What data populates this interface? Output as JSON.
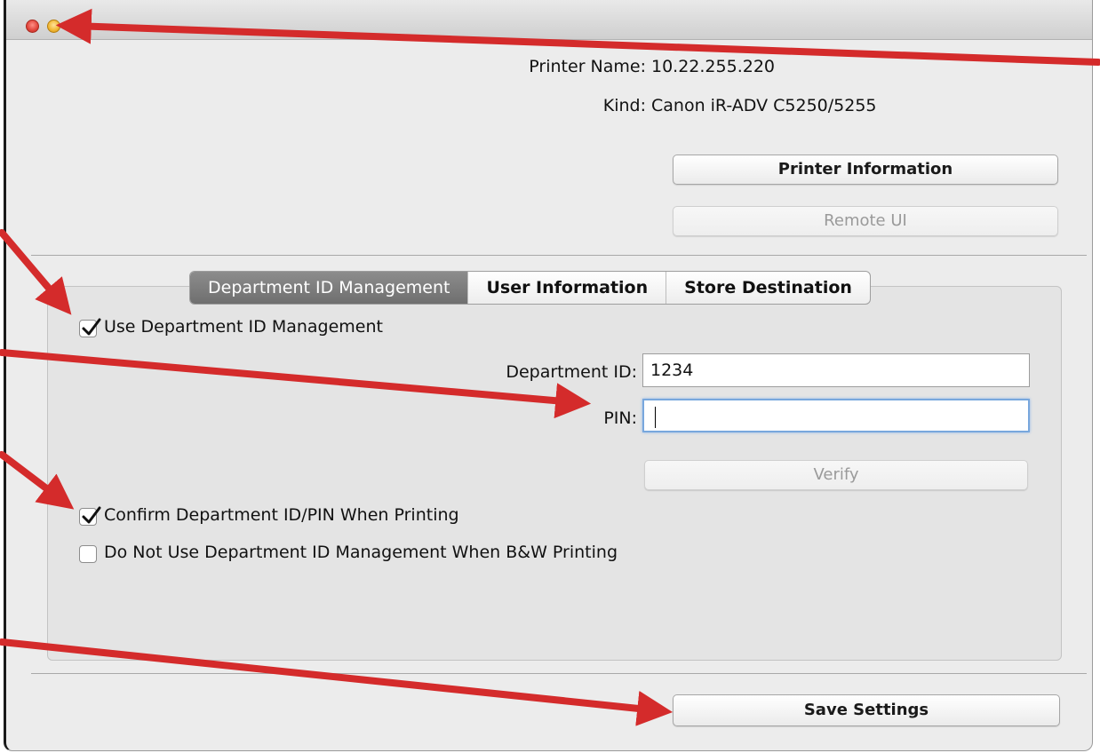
{
  "printer": {
    "name_label": "Printer Name:",
    "name_value": "10.22.255.220",
    "kind_label": "Kind:",
    "kind_value": "Canon iR-ADV C5250/5255",
    "info_button": "Printer Information",
    "remote_button": "Remote UI"
  },
  "tabs": [
    {
      "label": "Department ID Management",
      "active": true
    },
    {
      "label": "User Information",
      "active": false
    },
    {
      "label": "Store Destination",
      "active": false
    }
  ],
  "dept": {
    "use_management_label": "Use Department ID Management",
    "use_management_checked": true,
    "department_id_label": "Department ID:",
    "department_id_value": "1234",
    "pin_label": "PIN:",
    "pin_value": "",
    "verify_button": "Verify",
    "confirm_label": "Confirm Department ID/PIN When Printing",
    "confirm_checked": true,
    "bw_label": "Do Not Use Department ID Management When B&W Printing",
    "bw_checked": false
  },
  "footer": {
    "save_button": "Save Settings"
  },
  "colors": {
    "annotation_arrow": "#d42b2b",
    "focus_ring": "#78a7dd",
    "active_tab": "#7d7d7d"
  },
  "icons": [
    "close-traffic-light-icon",
    "minimize-traffic-light-icon",
    "checkmark-icon",
    "annotation-arrow-icon"
  ]
}
